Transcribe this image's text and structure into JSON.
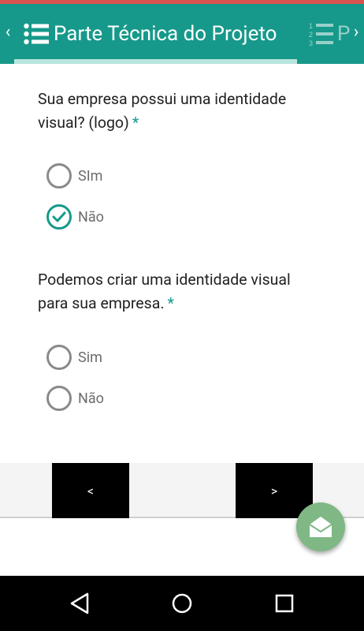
{
  "header": {
    "current_tab": "Parte Técnica do Projeto",
    "next_tab_partial": "P",
    "left_arrow": "‹",
    "right_arrow": "›"
  },
  "questions": [
    {
      "text": "Sua empresa possui uma identidade visual? (logo)",
      "required": "*",
      "options": [
        {
          "label": "SIm",
          "checked": false
        },
        {
          "label": "Não",
          "checked": true
        }
      ]
    },
    {
      "text": "Podemos criar uma identidade visual para sua empresa.",
      "required": "*",
      "options": [
        {
          "label": "Sim",
          "checked": false
        },
        {
          "label": "Não",
          "checked": false
        }
      ]
    }
  ],
  "navigation": {
    "prev_label": "<",
    "next_label": ">"
  },
  "colors": {
    "primary": "#16998a",
    "fab": "#7fb884",
    "status_strip": "#d9534f"
  },
  "icons": {
    "tab_icon": "list-icon",
    "next_tab_icon": "numbered-list-icon",
    "fab_icon": "envelope-open-icon",
    "system_back": "back-triangle-icon",
    "system_home": "home-circle-icon",
    "system_recent": "recent-square-icon"
  }
}
